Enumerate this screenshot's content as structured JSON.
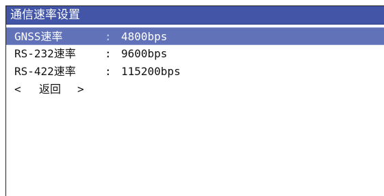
{
  "title": "通信速率设置",
  "items": [
    {
      "name": "GNSS速率",
      "sep": ":",
      "value": "4800bps",
      "selected": true
    },
    {
      "name": "RS-232速率",
      "sep": ":",
      "value": "9600bps",
      "selected": false
    },
    {
      "name": "RS-422速率",
      "sep": ":",
      "value": "115200bps",
      "selected": false
    }
  ],
  "back": {
    "left_arrow": "<",
    "label": "返回",
    "right_arrow": ">"
  },
  "colors": {
    "title_bg": "#4255a7",
    "selected_bg": "#6272b8"
  }
}
